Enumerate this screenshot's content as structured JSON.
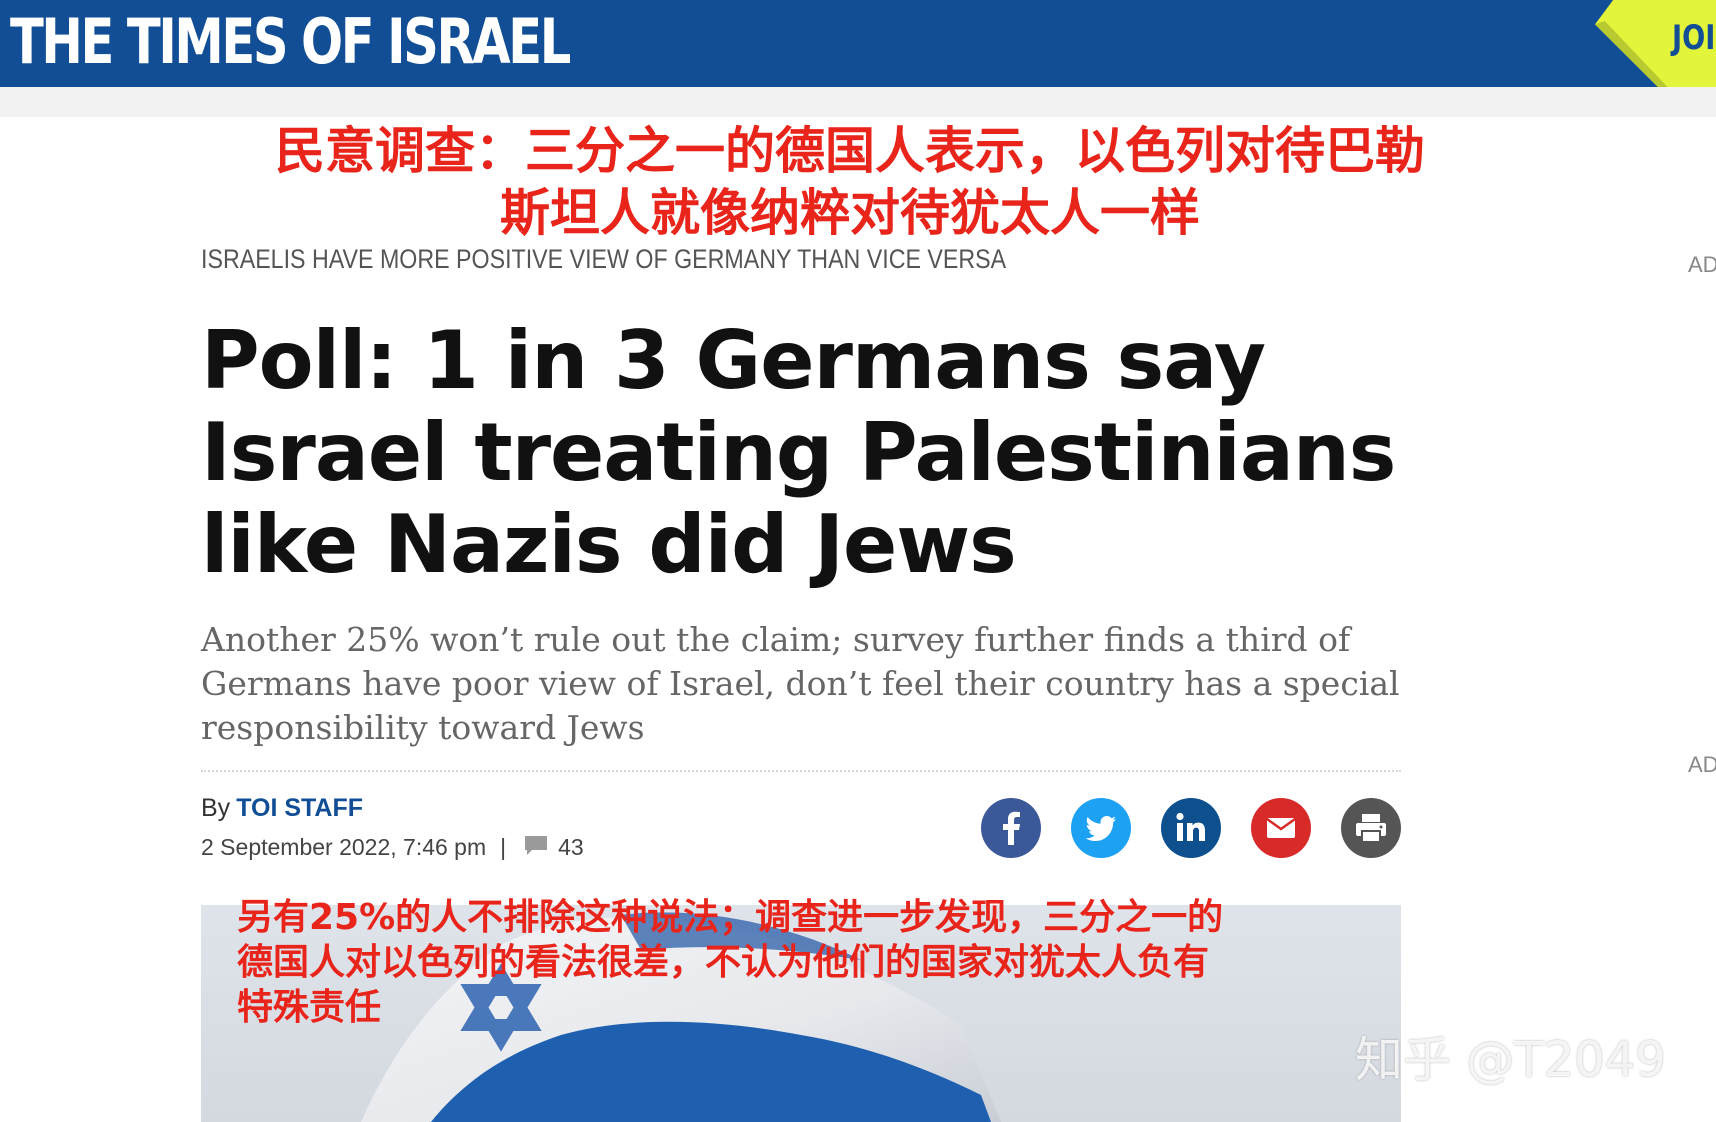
{
  "header": {
    "logo_text": "THE TIMES OF ISRAEL",
    "join_text": "JOI"
  },
  "overlay": {
    "chinese_title_line1": "民意调查：三分之一的德国人表示，以色列对待巴勒",
    "chinese_title_line2": "斯坦人就像纳粹对待犹太人一样",
    "chinese_subhead_line1": "另有25%的人不排除这种说法；调查进一步发现，三分之一的",
    "chinese_subhead_line2": "德国人对以色列的看法很差，不认为他们的国家对犹太人负有",
    "chinese_subhead_line3": "特殊责任",
    "watermark": "知乎 @T2049"
  },
  "article": {
    "kicker": "ISRAELIS HAVE MORE POSITIVE VIEW OF GERMANY THAN VICE VERSA",
    "headline": "Poll: 1 in 3 Germans say Israel treating Palestinians like Nazis did Jews",
    "subhead": "Another 25% won’t rule out the claim; survey further finds a third of Germans have poor view of Israel, don’t feel their country has a special responsibility toward Jews",
    "byline_prefix": "By",
    "author": "TOI STAFF",
    "date": "2 September 2022, 7:46 pm",
    "separator": "|",
    "comment_count": "43"
  },
  "ads": {
    "label_1": "AD",
    "label_2": "AD"
  },
  "share_buttons": [
    {
      "name": "facebook",
      "icon": "facebook-icon",
      "color": "#3b5998"
    },
    {
      "name": "twitter",
      "icon": "twitter-icon",
      "color": "#1da1f2"
    },
    {
      "name": "linkedin",
      "icon": "linkedin-icon",
      "color": "#0e4f8e"
    },
    {
      "name": "email",
      "icon": "mail-icon",
      "color": "#d92a2a"
    },
    {
      "name": "print",
      "icon": "printer-icon",
      "color": "#555555"
    }
  ],
  "colors": {
    "brand_blue": "#114e96",
    "join_yellow": "#e3f53a",
    "overlay_red": "#e8241b"
  }
}
